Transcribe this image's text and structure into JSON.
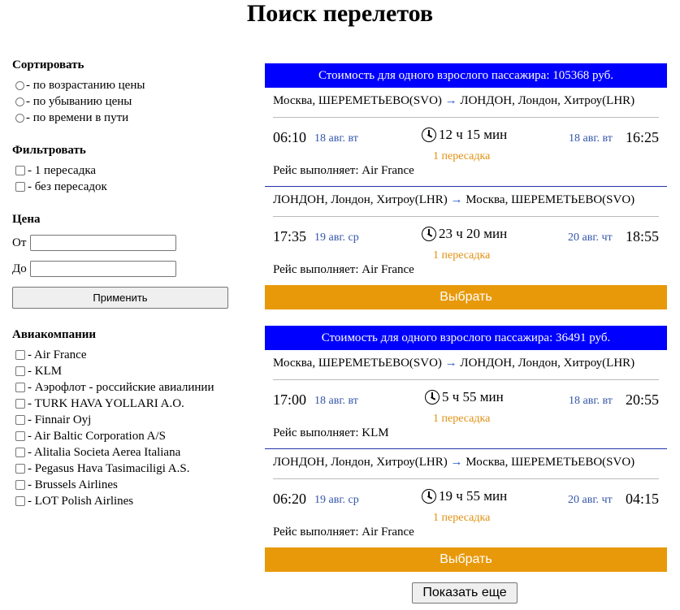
{
  "page_title": "Поиск перелетов",
  "sidebar": {
    "sort_title": "Сортировать",
    "sort_options": [
      "- по возрастанию цены",
      "- по убыванию цены",
      "- по времени в пути"
    ],
    "filter_title": "Фильтровать",
    "filter_options": [
      "- 1 пересадка",
      "- без пересадок"
    ],
    "price_title": "Цена",
    "price_from_label": "От",
    "price_to_label": "До",
    "apply_label": "Применить",
    "airlines_title": "Авиакомпании",
    "airlines": [
      "- Air France",
      "- KLM",
      "- Аэрофлот - российские авиалинии",
      "- TURK HAVA YOLLARI A.O.",
      "- Finnair Oyj",
      "- Air Baltic Corporation A/S",
      "- Alitalia Societa Aerea Italiana",
      "- Pegasus Hava Tasimaciligi A.S.",
      "- Brussels Airlines",
      "- LOT Polish Airlines"
    ]
  },
  "flights": [
    {
      "price_text": "Стоимость для одного взрослого пассажира: 105368 руб.",
      "segments": [
        {
          "from": "Москва, ШЕРЕМЕТЬЕВО(SVO)",
          "arrow": "→",
          "to": "ЛОНДОН, Лондон, Хитроу(LHR)",
          "dep_time": "06:10",
          "dep_date": "18 авг. вт",
          "duration": "12 ч 15 мин",
          "stops": "1 пересадка",
          "arr_date": "18 авг. вт",
          "arr_time": "16:25",
          "carrier": "Рейс выполняет: Air France"
        },
        {
          "from": "ЛОНДОН, Лондон, Хитроу(LHR)",
          "arrow": "→",
          "to": "Москва, ШЕРЕМЕТЬЕВО(SVO)",
          "dep_time": "17:35",
          "dep_date": "19 авг. ср",
          "duration": "23 ч 20 мин",
          "stops": "1 пересадка",
          "arr_date": "20 авг. чт",
          "arr_time": "18:55",
          "carrier": "Рейс выполняет: Air France"
        }
      ],
      "choose_label": "Выбрать"
    },
    {
      "price_text": "Стоимость для одного взрослого пассажира: 36491 руб.",
      "segments": [
        {
          "from": "Москва, ШЕРЕМЕТЬЕВО(SVO)",
          "arrow": "→",
          "to": "ЛОНДОН, Лондон, Хитроу(LHR)",
          "dep_time": "17:00",
          "dep_date": "18 авг. вт",
          "duration": "5 ч 55 мин",
          "stops": "1 пересадка",
          "arr_date": "18 авг. вт",
          "arr_time": "20:55",
          "carrier": "Рейс выполняет: KLM"
        },
        {
          "from": "ЛОНДОН, Лондон, Хитроу(LHR)",
          "arrow": "→",
          "to": "Москва, ШЕРЕМЕТЬЕВО(SVO)",
          "dep_time": "06:20",
          "dep_date": "19 авг. ср",
          "duration": "19 ч 55 мин",
          "stops": "1 пересадка",
          "arr_date": "20 авг. чт",
          "arr_time": "04:15",
          "carrier": "Рейс выполняет: Air France"
        }
      ],
      "choose_label": "Выбрать"
    }
  ],
  "show_more_label": "Показать еще",
  "colors": {
    "price_bar": "#0000ff",
    "choose_button": "#e8990a",
    "stops_text": "#e09010",
    "date_text": "#3355aa"
  }
}
